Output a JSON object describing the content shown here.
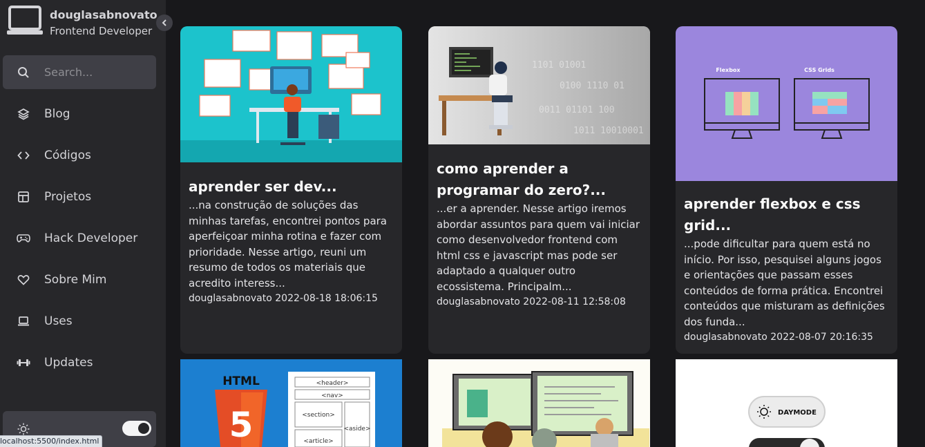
{
  "profile": {
    "name": "douglasabnovato",
    "role": "Frontend Developer"
  },
  "search": {
    "placeholder": "Search..."
  },
  "nav": [
    {
      "label": "Blog",
      "icon": "layers-icon"
    },
    {
      "label": "Códigos",
      "icon": "code-icon"
    },
    {
      "label": "Projetos",
      "icon": "layout-icon"
    },
    {
      "label": "Hack Developer",
      "icon": "gamepad-icon"
    },
    {
      "label": "Sobre Mim",
      "icon": "heart-icon"
    },
    {
      "label": "Uses",
      "icon": "laptop-icon"
    },
    {
      "label": "Updates",
      "icon": "dumbbell-icon"
    }
  ],
  "theme": {
    "icon": "sun-icon",
    "dark_mode_on": true
  },
  "statusbar": {
    "url": "localhost:5500/index.html"
  },
  "posts": [
    {
      "title": "aprender ser dev...",
      "excerpt": "...na construção de soluções das minhas tarefas, encontrei pontos para aperfeiçoar minha rotina e fazer com prioridade. Nesse artigo, reuni um resumo de todos os materiais que acredito interess...",
      "author": "douglasabnovato",
      "date": "2022-08-18 18:06:15",
      "thumb_color": "#1cc3cc"
    },
    {
      "title": "como aprender a programar do zero?...",
      "excerpt": "...er a aprender. Nesse artigo iremos abordar assuntos para quem vai iniciar como desenvolvedor frontend com html css e javascript mas pode ser adaptado a qualquer outro ecossistema. Principalm...",
      "author": "douglasabnovato",
      "date": "2022-08-11 12:58:08",
      "thumb_color": "#d6d6d6"
    },
    {
      "title": "aprender flexbox e css grid...",
      "excerpt": "...pode dificultar para quem está no início. Por isso, pesquisei alguns jogos e orientações que passam esses conteúdos de forma prática. Encontrei conteúdos que misturam as definições dos funda...",
      "author": "douglasabnovato",
      "date": "2022-08-07 20:16:35",
      "thumb_color": "#9b86dd",
      "thumb_labels": [
        "Flexbox",
        "CSS Grids"
      ]
    },
    {
      "thumb_color": "#1c7fd0",
      "thumb_labels": [
        "HTML",
        "5",
        "<header>",
        "<nav>",
        "<section>",
        "<aside>",
        "<article>"
      ]
    },
    {
      "thumb_color": "#fdfcf5"
    },
    {
      "thumb_color": "#ffffff",
      "thumb_labels": [
        "DAYMODE"
      ]
    }
  ],
  "colors": {
    "background": "#18181b",
    "sidebar": "#27272a",
    "surface": "#3f3f46"
  }
}
